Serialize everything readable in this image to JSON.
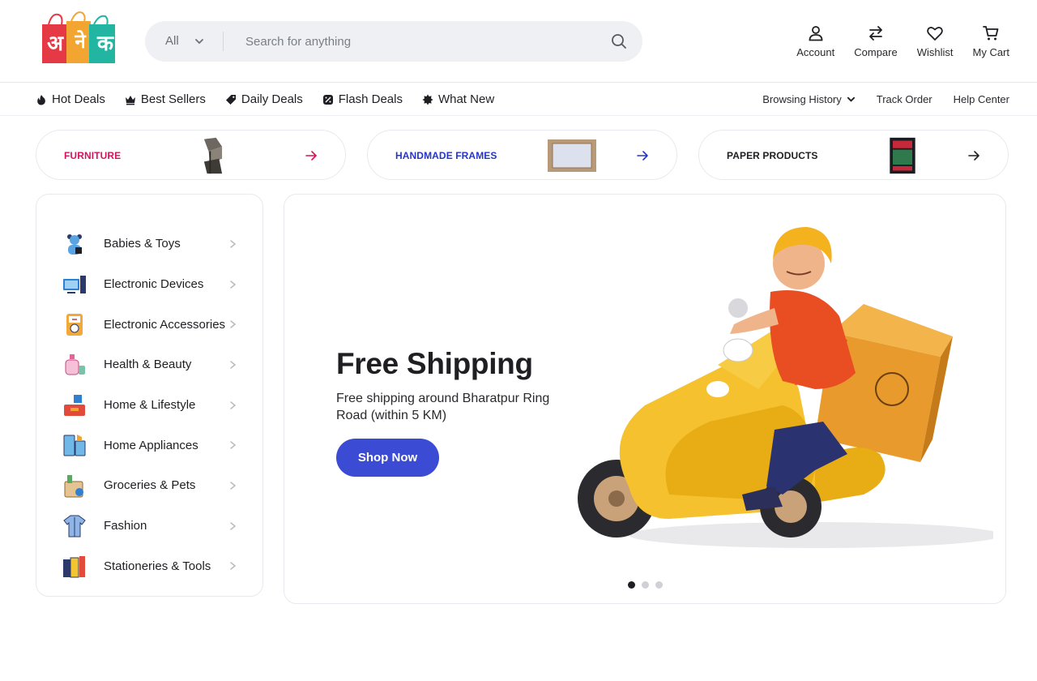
{
  "brand": {
    "logo_letters": [
      "अ",
      "ने",
      "क"
    ],
    "logo_colors": [
      "#e53946",
      "#f2a531",
      "#21b5a2"
    ]
  },
  "search": {
    "category": "All",
    "placeholder": "Search for anything"
  },
  "header_actions": [
    {
      "label": "Account",
      "icon": "user-icon"
    },
    {
      "label": "Compare",
      "icon": "compare-arrows-icon"
    },
    {
      "label": "Wishlist",
      "icon": "heart-icon"
    },
    {
      "label": "My Cart",
      "icon": "cart-icon"
    }
  ],
  "nav": {
    "items": [
      {
        "label": "Hot Deals",
        "icon": "flame-icon"
      },
      {
        "label": "Best Sellers",
        "icon": "crown-icon"
      },
      {
        "label": "Daily Deals",
        "icon": "tag-icon"
      },
      {
        "label": "Flash Deals",
        "icon": "flash-tag-icon"
      },
      {
        "label": "What New",
        "icon": "star-badge-icon"
      }
    ],
    "right_links": [
      "Browsing History",
      "Track Order",
      "Help Center"
    ]
  },
  "category_pills": [
    {
      "label": "FURNITURE",
      "color": "#d4145a",
      "arrow_color": "#d4145a"
    },
    {
      "label": "HANDMADE FRAMES",
      "color": "#2636c9",
      "arrow_color": "#2636c9"
    },
    {
      "label": "PAPER PRODUCTS",
      "color": "#1f1f23",
      "arrow_color": "#1f1f23"
    }
  ],
  "sidebar": {
    "items": [
      {
        "label": "Babies & Toys",
        "icon": "teddy-bear-icon"
      },
      {
        "label": "Electronic Devices",
        "icon": "computer-icon"
      },
      {
        "label": "Electronic Accessories",
        "icon": "multimeter-icon"
      },
      {
        "label": "Health & Beauty",
        "icon": "perfume-icon"
      },
      {
        "label": "Home & Lifestyle",
        "icon": "toolbox-icon"
      },
      {
        "label": "Home Appliances",
        "icon": "fridge-icon"
      },
      {
        "label": "Groceries & Pets",
        "icon": "grocery-bag-icon"
      },
      {
        "label": "Fashion",
        "icon": "shirt-icon"
      },
      {
        "label": "Stationeries & Tools",
        "icon": "stationery-icon"
      }
    ]
  },
  "banner": {
    "title": "Free Shipping",
    "subtitle": "Free shipping around Bharatpur Ring Road (within 5 KM)",
    "button": "Shop Now",
    "button_color": "#3b4bd3",
    "slides": 3,
    "active_slide": 1
  }
}
